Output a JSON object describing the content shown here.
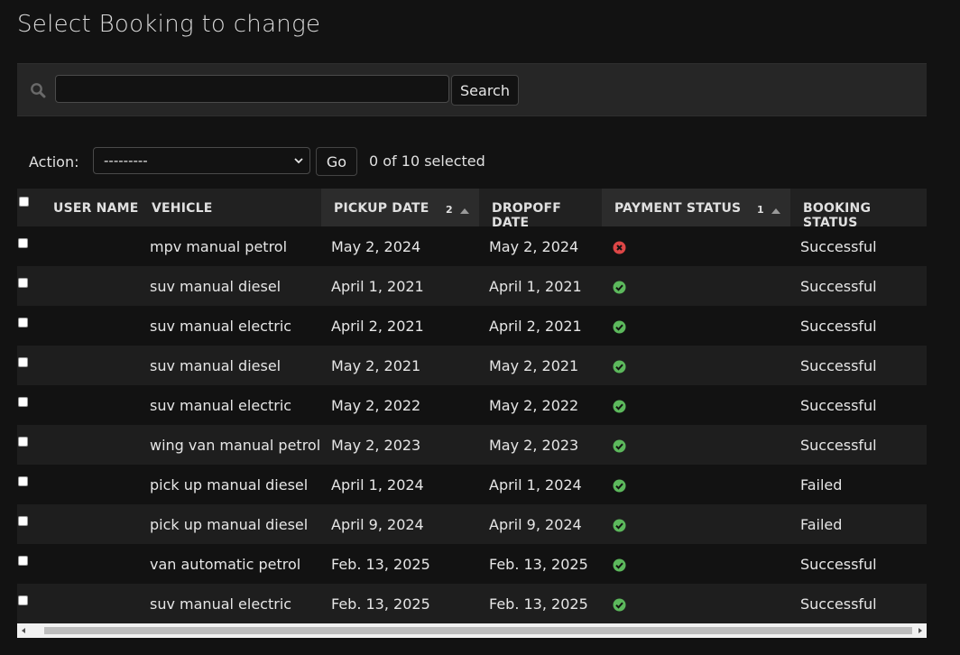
{
  "page": {
    "title": "Select Booking to change"
  },
  "search": {
    "value": "",
    "button_label": "Search"
  },
  "actions": {
    "label": "Action:",
    "selected_option": "---------",
    "go_label": "Go",
    "selected_count": "0 of 10 selected"
  },
  "table": {
    "headers": {
      "user_name": "USER NAME",
      "vehicle": "VEHICLE",
      "pickup_date": "PICKUP DATE",
      "pickup_sort_priority": "2",
      "dropoff_date": "DROPOFF DATE",
      "payment_status": "PAYMENT STATUS",
      "payment_sort_priority": "1",
      "booking_status": "BOOKING STATUS"
    },
    "rows": [
      {
        "user": "",
        "vehicle": "mpv manual petrol",
        "pickup": "May 2, 2024",
        "dropoff": "May 2, 2024",
        "payment": "failed",
        "booking": "Successful"
      },
      {
        "user": "",
        "vehicle": "suv manual diesel",
        "pickup": "April 1, 2021",
        "dropoff": "April 1, 2021",
        "payment": "paid",
        "booking": "Successful"
      },
      {
        "user": "",
        "vehicle": "suv manual electric",
        "pickup": "April 2, 2021",
        "dropoff": "April 2, 2021",
        "payment": "paid",
        "booking": "Successful"
      },
      {
        "user": "",
        "vehicle": "suv manual diesel",
        "pickup": "May 2, 2021",
        "dropoff": "May 2, 2021",
        "payment": "paid",
        "booking": "Successful"
      },
      {
        "user": "",
        "vehicle": "suv manual electric",
        "pickup": "May 2, 2022",
        "dropoff": "May 2, 2022",
        "payment": "paid",
        "booking": "Successful"
      },
      {
        "user": "",
        "vehicle": "wing van manual petrol",
        "pickup": "May 2, 2023",
        "dropoff": "May 2, 2023",
        "payment": "paid",
        "booking": "Successful"
      },
      {
        "user": "",
        "vehicle": "pick up manual diesel",
        "pickup": "April 1, 2024",
        "dropoff": "April 1, 2024",
        "payment": "paid",
        "booking": "Failed"
      },
      {
        "user": "",
        "vehicle": "pick up manual diesel",
        "pickup": "April 9, 2024",
        "dropoff": "April 9, 2024",
        "payment": "paid",
        "booking": "Failed"
      },
      {
        "user": "",
        "vehicle": "van automatic petrol",
        "pickup": "Feb. 13, 2025",
        "dropoff": "Feb. 13, 2025",
        "payment": "paid",
        "booking": "Successful"
      },
      {
        "user": "",
        "vehicle": "suv manual electric",
        "pickup": "Feb. 13, 2025",
        "dropoff": "Feb. 13, 2025",
        "payment": "paid",
        "booking": "Successful"
      }
    ]
  },
  "icons": {
    "paid": "check-circle-icon",
    "failed": "x-circle-icon"
  },
  "colors": {
    "paid": "#5cb85c",
    "failed": "#dd4646",
    "background": "#121212"
  }
}
